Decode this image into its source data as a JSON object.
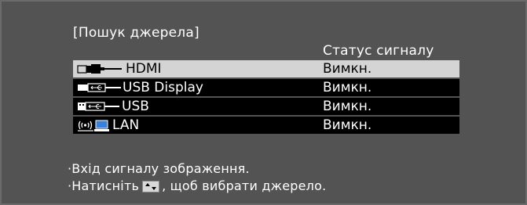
{
  "dialog": {
    "title": "[Пошук джерела]",
    "status_header": "Статус сигналу"
  },
  "sources": [
    {
      "name": "HDMI",
      "status": "Вимкн.",
      "icon": "hdmi-icon",
      "selected": true
    },
    {
      "name": "USB Display",
      "status": "Вимкн.",
      "icon": "usb-display-icon",
      "selected": false
    },
    {
      "name": "USB",
      "status": "Вимкн.",
      "icon": "usb-icon",
      "selected": false
    },
    {
      "name": "LAN",
      "status": "Вимкн.",
      "icon": "lan-icon",
      "selected": false
    }
  ],
  "footer": {
    "line1": "·Вхід сигналу зображення.",
    "line2_prefix": "·Натисніть",
    "line2_suffix": ", щоб вибрати джерело.",
    "key_icon": "up-down-arrow-key-icon"
  },
  "colors": {
    "background": "#535353",
    "row_background": "#000000",
    "selected_row_background": "#d4d4d4",
    "text": "#ffffff"
  }
}
